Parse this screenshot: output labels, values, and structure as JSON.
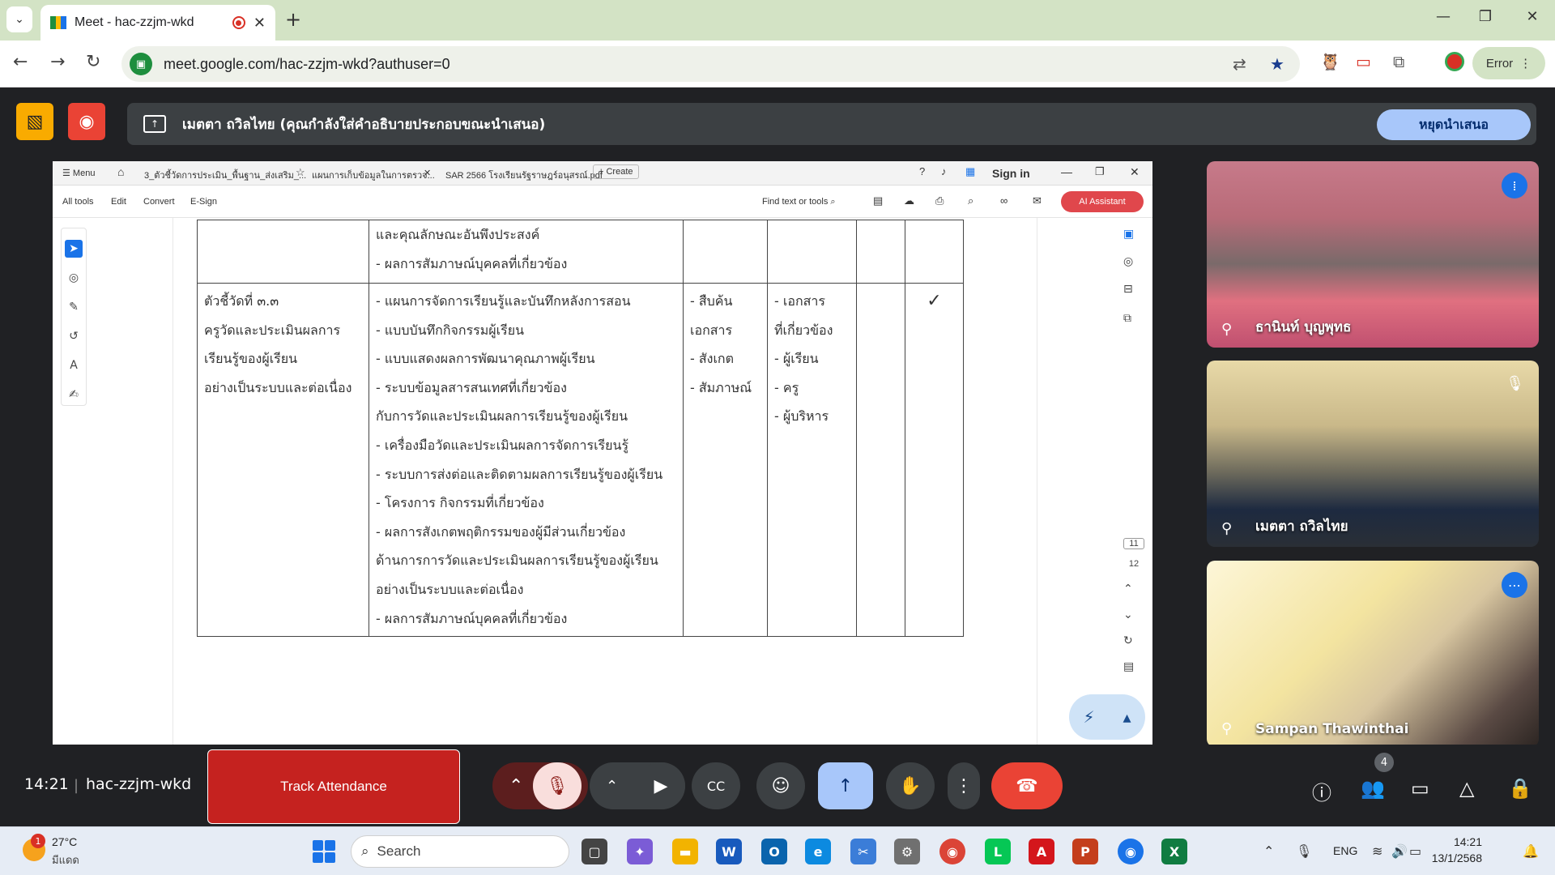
{
  "browser": {
    "tab_title": "Meet - hac-zzjm-wkd",
    "url": "meet.google.com/hac-zzjm-wkd?authuser=0",
    "profile_label": "Error",
    "colors": {
      "tabstrip": "#d3e3c5"
    }
  },
  "meet": {
    "presenting_text": "เมตตา ถวิลไทย (คุณกำลังใส่คำอธิบายประกอบขณะนำเสนอ)",
    "stop_presenting_label": "หยุดนำเสนอ",
    "time": "14:21",
    "meeting_code": "hac-zzjm-wkd",
    "track_attendance_label": "Track Attendance",
    "people_count": "4",
    "participants": [
      {
        "name": "ธานินท์ บุญพุทธ"
      },
      {
        "name": "เมตตา ถวิลไทย"
      },
      {
        "name": "Sampan Thawinthai"
      }
    ]
  },
  "acrobat": {
    "tabs": {
      "menu": "Menu",
      "tab1": "3_ตัวชี้วัดการประเมิน_พื้นฐาน_ส่งเสริม_...",
      "tab2": "แผนการเก็บข้อมูลในการตรวจ...",
      "tab3": "SAR 2566 โรงเรียนรัฐราษฎร์อนุสรณ์.pdf",
      "create": "Create",
      "sign_in": "Sign in"
    },
    "toolbar": {
      "all_tools": "All tools",
      "edit": "Edit",
      "convert": "Convert",
      "esign": "E-Sign",
      "find": "Find text or tools",
      "ai_assistant": "AI Assistant"
    },
    "page_numbers": [
      "11",
      "12"
    ],
    "table": {
      "top_row_lines": [
        "และคุณลักษณะอันพึงประสงค์",
        "- ผลการสัมภาษณ์บุคคลที่เกี่ยวข้อง"
      ],
      "indicator_lines": [
        "ตัวชี้วัดที่ ๓.๓",
        "ครูวัดและประเมินผลการ",
        "เรียนรู้ของผู้เรียน",
        "อย่างเป็นระบบและต่อเนื่อง"
      ],
      "evidence_lines": [
        "- แผนการจัดการเรียนรู้และบันทึกหลังการสอน",
        "- แบบบันทึกกิจกรรมผู้เรียน",
        "- แบบแสดงผลการพัฒนาคุณภาพผู้เรียน",
        "- ระบบข้อมูลสารสนเทศที่เกี่ยวข้อง",
        "กับการวัดและประเมินผลการเรียนรู้ของผู้เรียน",
        "- เครื่องมือวัดและประเมินผลการจัดการเรียนรู้",
        "- ระบบการส่งต่อและติดตามผลการเรียนรู้ของผู้เรียน",
        "- โครงการ กิจกรรมที่เกี่ยวข้อง",
        "- ผลการสังเกตพฤติกรรมของผู้มีส่วนเกี่ยวข้อง",
        "ด้านการการวัดและประเมินผลการเรียนรู้ของผู้เรียน",
        "อย่างเป็นระบบและต่อเนื่อง",
        "- ผลการสัมภาษณ์บุคคลที่เกี่ยวข้อง"
      ],
      "method_lines": [
        "- สืบค้น",
        "เอกสาร",
        "- สังเกต",
        "- สัมภาษณ์"
      ],
      "source_lines": [
        "- เอกสาร",
        "ที่เกี่ยวข้อง",
        "- ผู้เรียน",
        "- ครู",
        "- ผู้บริหาร"
      ],
      "check_mark": "✓"
    }
  },
  "taskbar": {
    "weather_badge": "1",
    "temperature": "27°C",
    "condition": "มีแดด",
    "search_label": "Search",
    "language": "ENG",
    "time": "14:21",
    "date": "13/1/2568"
  }
}
